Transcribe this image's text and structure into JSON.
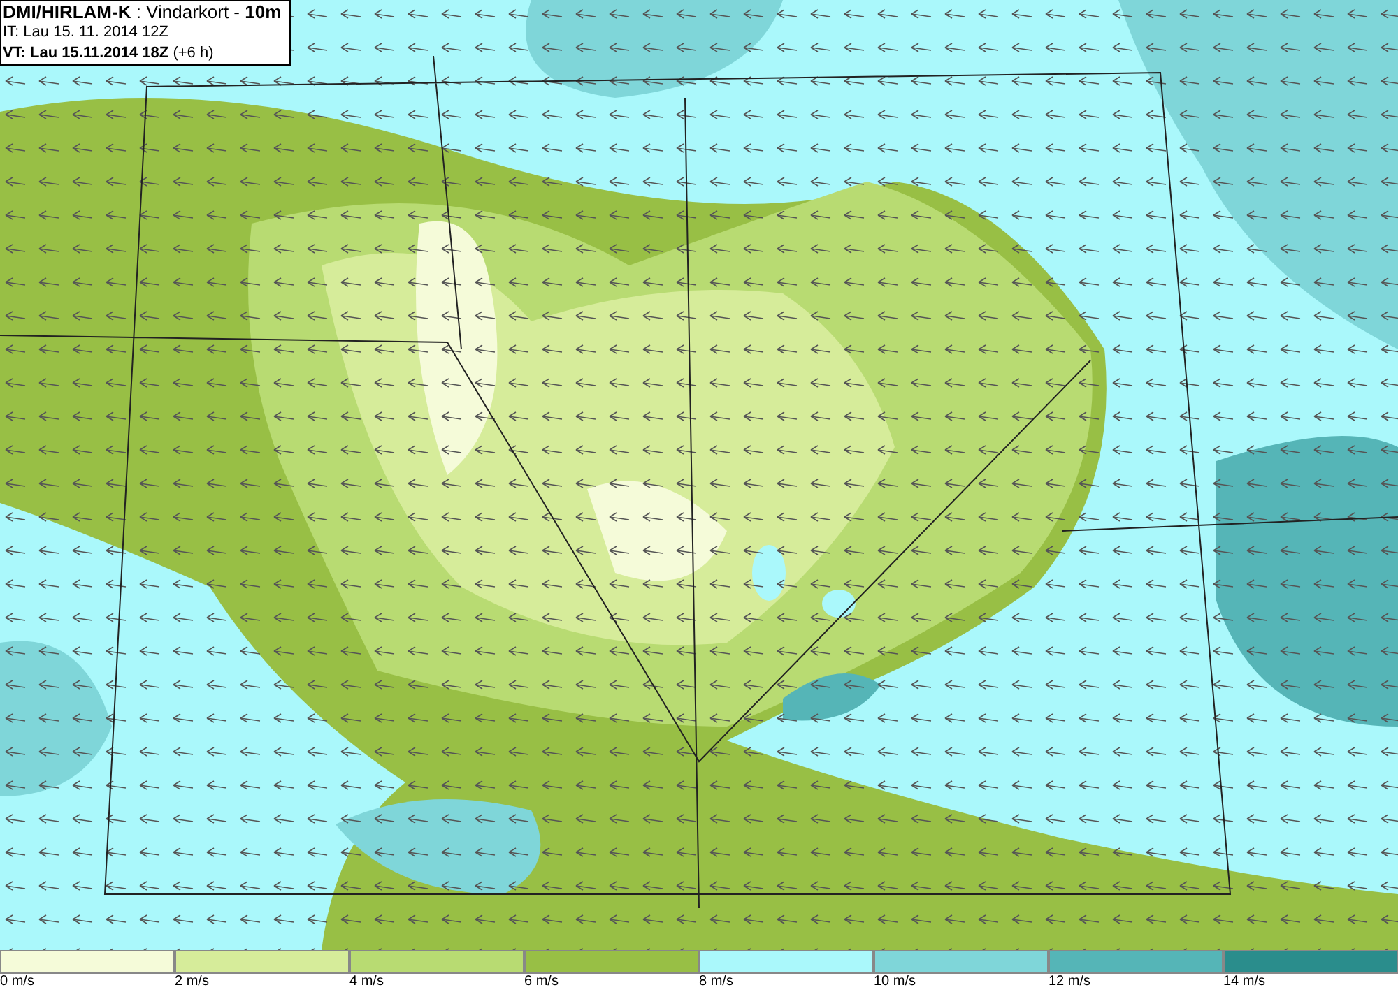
{
  "header": {
    "title": "**DMI/HIRLAM-K** : Vindarkort - **10m**",
    "initial_time": "IT: Lau 15. 11. 2014 12Z",
    "valid_time": "**VT: Lau 15.11.2014 18Z** (+6 h)"
  },
  "legend": [
    {
      "label": "0 m/s",
      "color": "#f5fbd9"
    },
    {
      "label": "2 m/s",
      "color": "#d6ec9a"
    },
    {
      "label": "4 m/s",
      "color": "#b8db72"
    },
    {
      "label": "6 m/s",
      "color": "#98bf45"
    },
    {
      "label": "8 m/s",
      "color": "#aaf8fb"
    },
    {
      "label": "10 m/s",
      "color": "#7fd6d9"
    },
    {
      "label": "12 m/s",
      "color": "#55b5b7"
    },
    {
      "label": "14 m/s",
      "color": "#2a8d8c"
    }
  ]
}
